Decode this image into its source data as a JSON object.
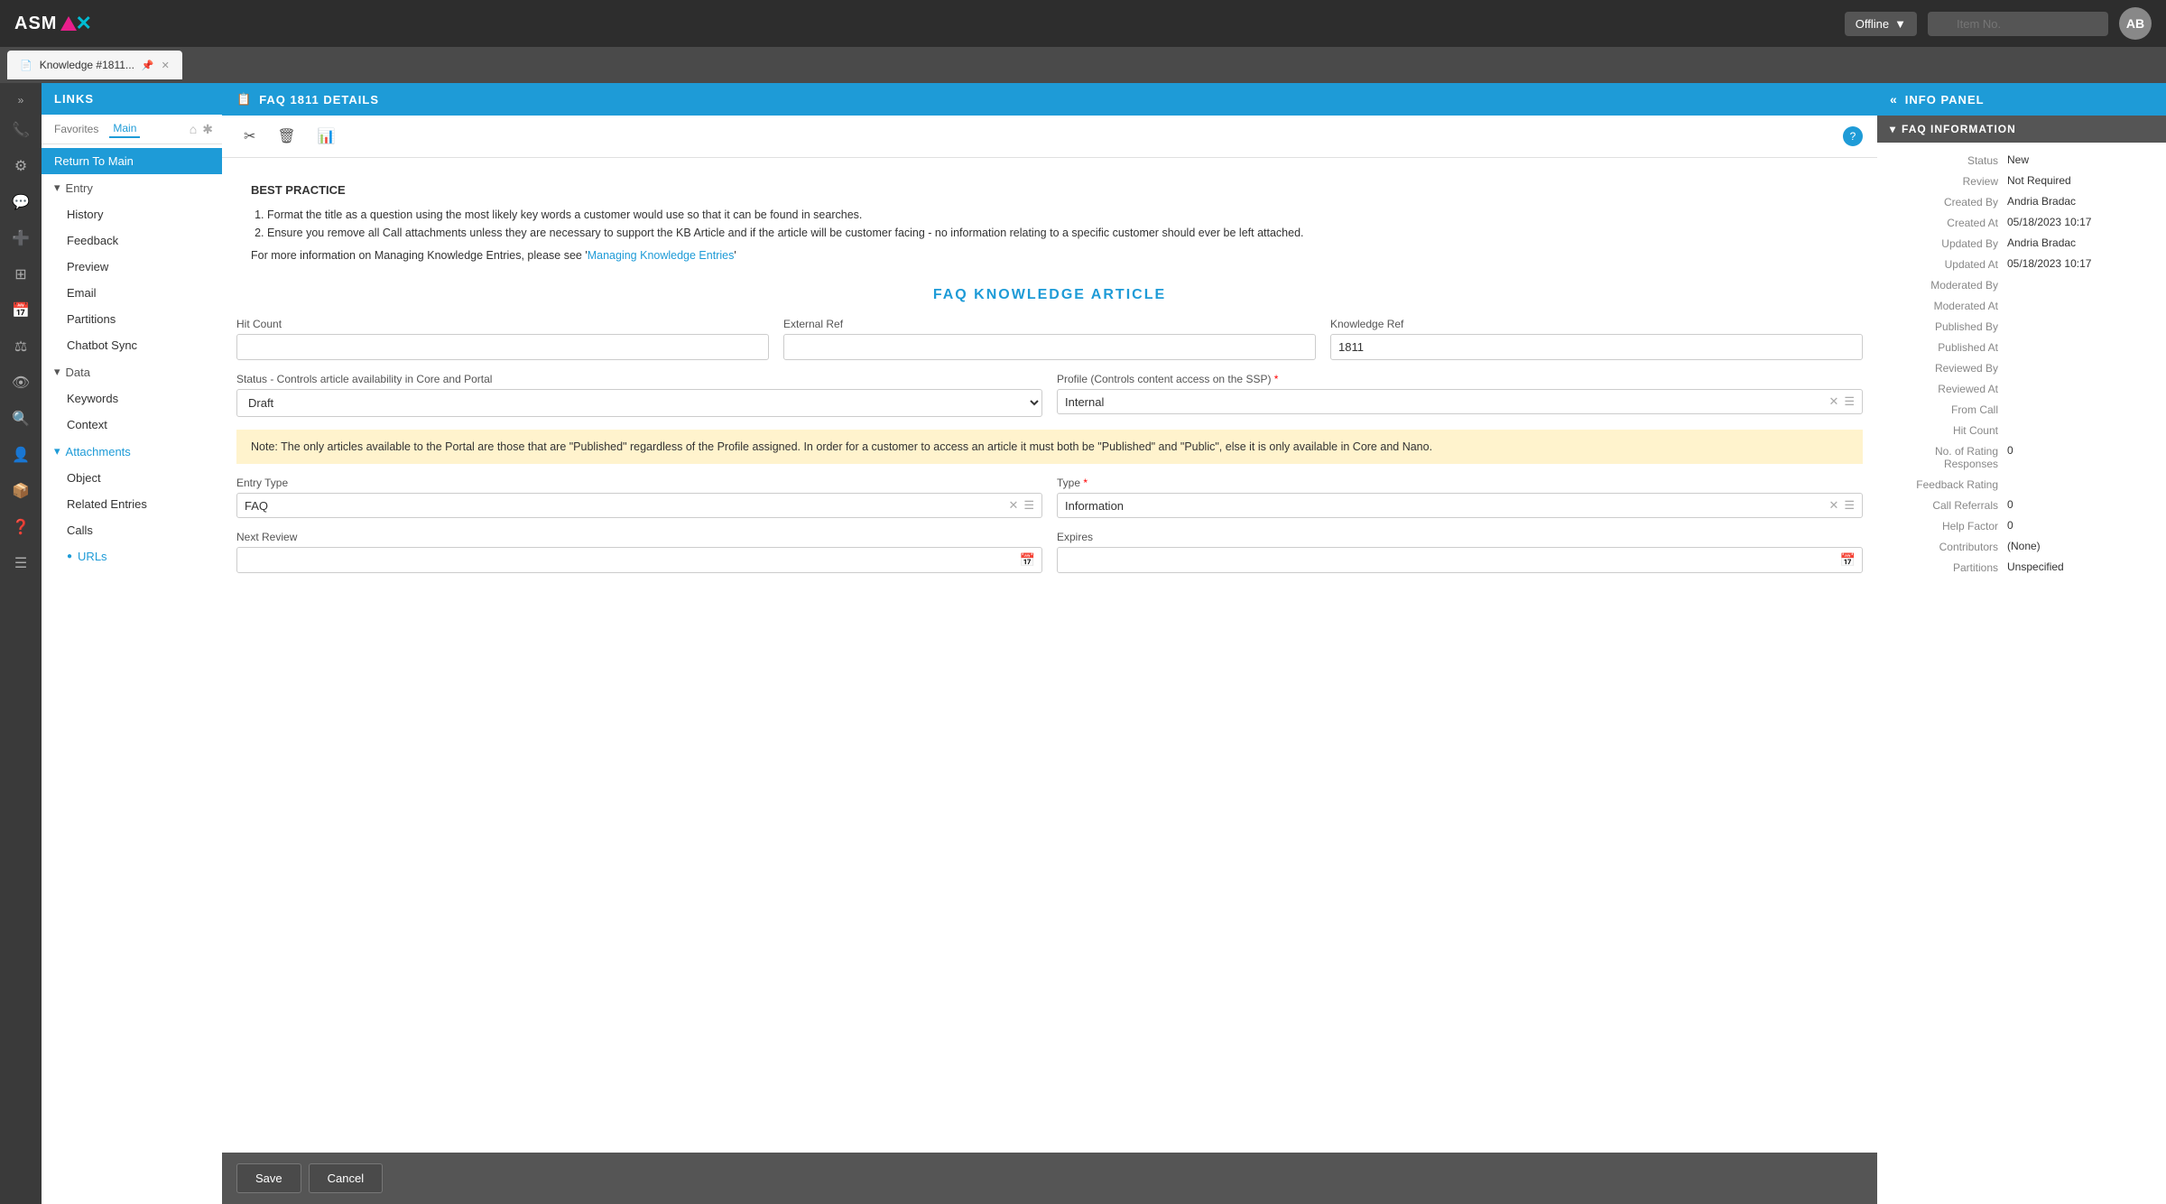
{
  "topbar": {
    "logo_text": "ASM",
    "status_label": "Offline",
    "search_placeholder": "Item No.",
    "avatar_initials": "AB"
  },
  "tab": {
    "title": "Knowledge #1811...",
    "icon": "📄",
    "pin_icon": "📌"
  },
  "links_panel": {
    "header": "LINKS",
    "tabs": [
      {
        "label": "Favorites",
        "active": false
      },
      {
        "label": "Main",
        "active": true
      }
    ],
    "nav_items": [
      {
        "label": "Return To Main",
        "type": "item",
        "indent": 0
      },
      {
        "label": "Entry",
        "type": "section",
        "indent": 0
      },
      {
        "label": "History",
        "type": "child",
        "indent": 1
      },
      {
        "label": "Feedback",
        "type": "child",
        "indent": 1
      },
      {
        "label": "Preview",
        "type": "child",
        "indent": 1
      },
      {
        "label": "Email",
        "type": "child",
        "indent": 1
      },
      {
        "label": "Partitions",
        "type": "child",
        "indent": 1
      },
      {
        "label": "Chatbot Sync",
        "type": "child",
        "indent": 1
      },
      {
        "label": "Data",
        "type": "section",
        "indent": 0
      },
      {
        "label": "Keywords",
        "type": "child",
        "indent": 1
      },
      {
        "label": "Context",
        "type": "child",
        "indent": 1
      },
      {
        "label": "Attachments",
        "type": "section-blue",
        "indent": 0
      },
      {
        "label": "Object",
        "type": "child",
        "indent": 1
      },
      {
        "label": "Related Entries",
        "type": "child",
        "indent": 1
      },
      {
        "label": "Calls",
        "type": "child",
        "indent": 1
      },
      {
        "label": "URLs",
        "type": "child-blue",
        "indent": 1
      }
    ]
  },
  "content": {
    "header": "FAQ 1811 DETAILS",
    "header_icon": "📋",
    "best_practice": {
      "title": "BEST PRACTICE",
      "items": [
        "Format the title as a question using the most likely key words a customer would use so that it can be found in searches.",
        "Ensure you remove all Call attachments unless they are necessary to support the KB Article and if the article will be customer facing - no information relating to a specific customer should ever be left attached."
      ],
      "footer_text": "For more information on Managing Knowledge Entries, please see '",
      "footer_link": "Managing Knowledge Entries",
      "footer_end": "'"
    },
    "faq_title": "FAQ KNOWLEDGE ARTICLE",
    "fields": {
      "hit_count_label": "Hit Count",
      "external_ref_label": "External Ref",
      "knowledge_ref_label": "Knowledge Ref",
      "knowledge_ref_value": "1811",
      "status_label": "Status - Controls article availability in Core and Portal",
      "status_value": "Draft",
      "profile_label": "Profile (Controls content access on the SSP)",
      "profile_value": "Internal",
      "note_text": "Note: The only articles available to the Portal are those that are \"Published\" regardless of the Profile assigned.  In order for a customer to access an article it must both be \"Published\" and \"Public\", else it is only available in Core and Nano.",
      "entry_type_label": "Entry Type",
      "entry_type_value": "FAQ",
      "type_label": "Type",
      "type_value": "Information",
      "next_review_label": "Next Review",
      "expires_label": "Expires"
    },
    "buttons": {
      "save": "Save",
      "cancel": "Cancel"
    }
  },
  "info_panel": {
    "header": "INFO PANEL",
    "section_header": "FAQ INFORMATION",
    "fields": [
      {
        "label": "Status",
        "value": "New"
      },
      {
        "label": "Review",
        "value": "Not Required"
      },
      {
        "label": "Created By",
        "value": "Andria Bradac"
      },
      {
        "label": "Created At",
        "value": "05/18/2023 10:17"
      },
      {
        "label": "Updated By",
        "value": "Andria Bradac"
      },
      {
        "label": "Updated At",
        "value": "05/18/2023 10:17"
      },
      {
        "label": "Moderated By",
        "value": ""
      },
      {
        "label": "Moderated At",
        "value": ""
      },
      {
        "label": "Published By",
        "value": ""
      },
      {
        "label": "Published At",
        "value": ""
      },
      {
        "label": "Reviewed By",
        "value": ""
      },
      {
        "label": "Reviewed At",
        "value": ""
      },
      {
        "label": "From Call",
        "value": ""
      },
      {
        "label": "Hit Count",
        "value": ""
      },
      {
        "label": "No. of Rating Responses",
        "value": "0"
      },
      {
        "label": "Feedback Rating",
        "value": ""
      },
      {
        "label": "Call Referrals",
        "value": "0"
      },
      {
        "label": "Help Factor",
        "value": "0"
      },
      {
        "label": "Contributors",
        "value": "(None)"
      },
      {
        "label": "Partitions",
        "value": "Unspecified"
      }
    ]
  },
  "icons": {
    "chevron_double_left": "«",
    "chevron_down": "▼",
    "chevron_right": "▶",
    "arrow_left": "←",
    "search": "🔍",
    "pin": "📌",
    "close": "✕",
    "scissors": "✂",
    "trash": "🗑",
    "chart": "📊",
    "help": "?",
    "home": "⌂",
    "grid": "⊞",
    "collapse": "◀◀"
  }
}
